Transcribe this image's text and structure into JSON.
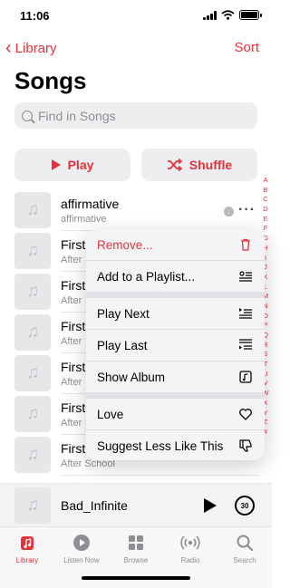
{
  "status": {
    "time": "11:06"
  },
  "nav": {
    "back_label": "Library",
    "sort_label": "Sort"
  },
  "page": {
    "title": "Songs"
  },
  "search": {
    "placeholder": "Find in Songs"
  },
  "actions": {
    "play_label": "Play",
    "shuffle_label": "Shuffle"
  },
  "songs": [
    {
      "title": "affirmative",
      "subtitle": "affirmative"
    },
    {
      "title": "First",
      "subtitle": "After"
    },
    {
      "title": "First",
      "subtitle": "After"
    },
    {
      "title": "First",
      "subtitle": "After"
    },
    {
      "title": "First",
      "subtitle": "After"
    },
    {
      "title": "First",
      "subtitle": "After"
    },
    {
      "title": "First",
      "subtitle": "After School"
    }
  ],
  "index_letters": [
    "A",
    "B",
    "C",
    "D",
    "E",
    "F",
    "G",
    "H",
    "I",
    "J",
    "K",
    "L",
    "M",
    "N",
    "O",
    "P",
    "Q",
    "R",
    "S",
    "T",
    "U",
    "V",
    "W",
    "X",
    "Y",
    "Z",
    "#"
  ],
  "context_menu": {
    "remove": "Remove...",
    "add_to_playlist": "Add to a Playlist...",
    "play_next": "Play Next",
    "play_last": "Play Last",
    "show_album": "Show Album",
    "love": "Love",
    "suggest_less": "Suggest Less Like This"
  },
  "now_playing": {
    "title": "Bad_Infinite",
    "skip_seconds": "30"
  },
  "tabs": [
    {
      "label": "Library",
      "icon": "library-icon"
    },
    {
      "label": "Listen Now",
      "icon": "listen-now-icon"
    },
    {
      "label": "Browse",
      "icon": "browse-icon"
    },
    {
      "label": "Radio",
      "icon": "radio-icon"
    },
    {
      "label": "Search",
      "icon": "search-icon"
    }
  ],
  "colors": {
    "accent": "#e5323b",
    "secondary_text": "#8e8e93"
  }
}
